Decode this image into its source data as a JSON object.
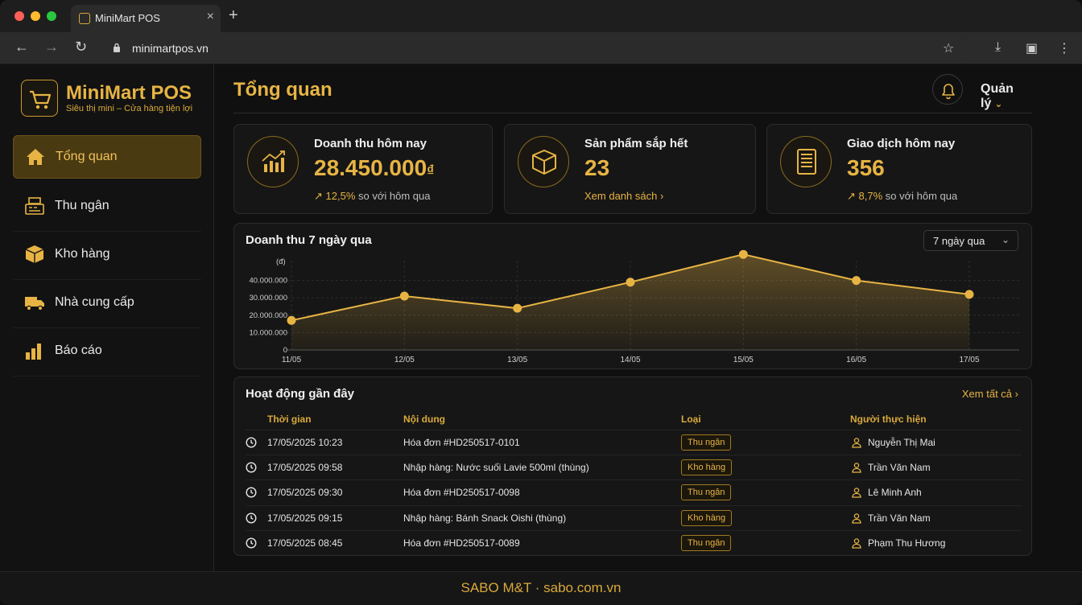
{
  "browser": {
    "tab_title": "MiniMart POS",
    "url": "minimartpos.vn"
  },
  "brand": {
    "name": "MiniMart POS",
    "tagline": "Siêu thị mini – Cửa hàng tiện lợi",
    "accent": "#e7b444"
  },
  "sidebar": {
    "items": [
      {
        "label": "Tổng quan",
        "icon": "home-icon",
        "active": true
      },
      {
        "label": "Thu ngân",
        "icon": "cash-register-icon",
        "active": false
      },
      {
        "label": "Kho hàng",
        "icon": "box-icon",
        "active": false
      },
      {
        "label": "Nhà cung cấp",
        "icon": "truck-icon",
        "active": false
      },
      {
        "label": "Báo cáo",
        "icon": "bar-chart-icon",
        "active": false
      }
    ]
  },
  "header": {
    "title": "Tổng quan",
    "user_menu": "Quản lý"
  },
  "stats": [
    {
      "label": "Doanh thu hôm nay",
      "value": "28.450.000",
      "currency": "₫",
      "change": "12,5%",
      "note": "so với hôm qua",
      "icon": "trending-chart-icon"
    },
    {
      "label": "Sản phẩm sắp hết",
      "value": "23",
      "link": "Xem danh sách",
      "icon": "package-icon"
    },
    {
      "label": "Giao dịch hôm nay",
      "value": "356",
      "change": "8,7%",
      "note": "so với hôm qua",
      "icon": "receipt-icon"
    }
  ],
  "chart": {
    "title": "Doanh thu 7 ngày qua",
    "range": "7 ngày qua"
  },
  "chart_data": {
    "type": "area",
    "title": "Doanh thu 7 ngày qua",
    "ylabel": "(đ)",
    "categories": [
      "11/05",
      "12/05",
      "13/05",
      "14/05",
      "15/05",
      "16/05",
      "17/05"
    ],
    "values": [
      17000000,
      31000000,
      24000000,
      39000000,
      55000000,
      40000000,
      32000000
    ],
    "ylim": [
      0,
      50000000
    ],
    "yticks": [
      "0",
      "10.000.000",
      "20.000.000",
      "30.000.000",
      "40.000.000"
    ],
    "grid": true,
    "color": "#e7b444"
  },
  "activity": {
    "title": "Hoạt động gần đây",
    "view_all": "Xem tất cả",
    "columns": [
      "Thời gian",
      "Nội dung",
      "Loại",
      "Người thực hiện"
    ],
    "rows": [
      {
        "time": "17/05/2025 10:23",
        "content": "Hóa đơn #HD250517-0101",
        "type": "Thu ngân",
        "user": "Nguyễn Thị Mai"
      },
      {
        "time": "17/05/2025 09:58",
        "content": "Nhập hàng: Nước suối Lavie 500ml (thùng)",
        "type": "Kho hàng",
        "user": "Trần Văn Nam"
      },
      {
        "time": "17/05/2025 09:30",
        "content": "Hóa đơn #HD250517-0098",
        "type": "Thu ngân",
        "user": "Lê Minh Anh"
      },
      {
        "time": "17/05/2025 09:15",
        "content": "Nhập hàng: Bánh Snack Oishi (thùng)",
        "type": "Kho hàng",
        "user": "Trần Văn Nam"
      },
      {
        "time": "17/05/2025 08:45",
        "content": "Hóa đơn #HD250517-0089",
        "type": "Thu ngân",
        "user": "Phạm Thu Hương"
      }
    ]
  },
  "footer": {
    "text": "SABO M&T · sabo.com.vn"
  }
}
